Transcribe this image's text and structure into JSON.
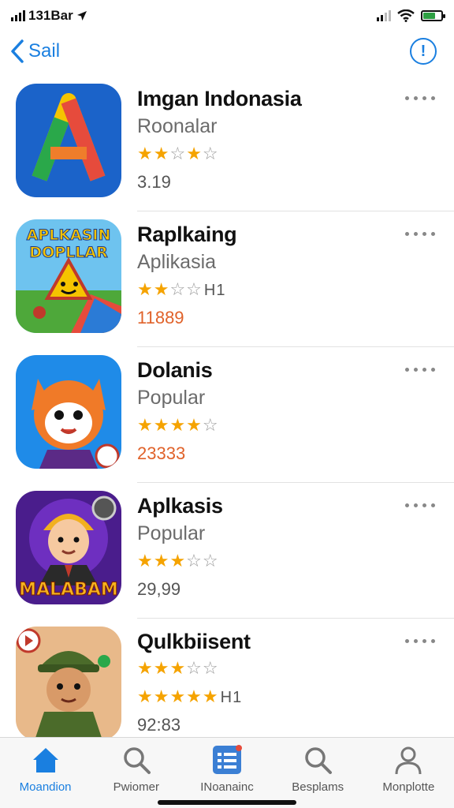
{
  "status_bar": {
    "time": "131Bar",
    "battery_color": "#2ea043"
  },
  "nav": {
    "back_label": "Sail",
    "info_label": "!"
  },
  "apps": [
    {
      "title": "Imgan Indonasia",
      "subtitle": "Roonalar",
      "stars": "★★☆★☆",
      "rating_count": "",
      "meta": "3.19"
    },
    {
      "title": "Raplkaing",
      "subtitle": "Aplikasia",
      "stars": "★★☆☆",
      "rating_count": "H1",
      "meta": "11889",
      "icon_text": [
        "APLKASIN",
        "DOPLLAR"
      ]
    },
    {
      "title": "Dolanis",
      "subtitle": "Popular",
      "stars": "★★★★☆",
      "rating_count": "",
      "meta": "23333"
    },
    {
      "title": "Aplkasis",
      "subtitle": "Popular",
      "stars": "★★★☆☆",
      "rating_count": "",
      "meta": "29,99",
      "icon_text": [
        "MALABAM"
      ]
    },
    {
      "title": "Qulkbiisent",
      "subtitle": "★★★☆☆",
      "stars": "★★★★★",
      "rating_count": "H1",
      "meta": "92:83"
    }
  ],
  "tabs": [
    {
      "label": "Moandion",
      "icon": "home-icon"
    },
    {
      "label": "Pwiomer",
      "icon": "search-icon"
    },
    {
      "label": "INoanainc",
      "icon": "list-icon"
    },
    {
      "label": "Besplams",
      "icon": "search-icon"
    },
    {
      "label": "Monplotte",
      "icon": "person-icon"
    }
  ],
  "colors": {
    "accent": "#1a7fe0",
    "star": "#f5a300",
    "price_orange": "#e0622a"
  }
}
